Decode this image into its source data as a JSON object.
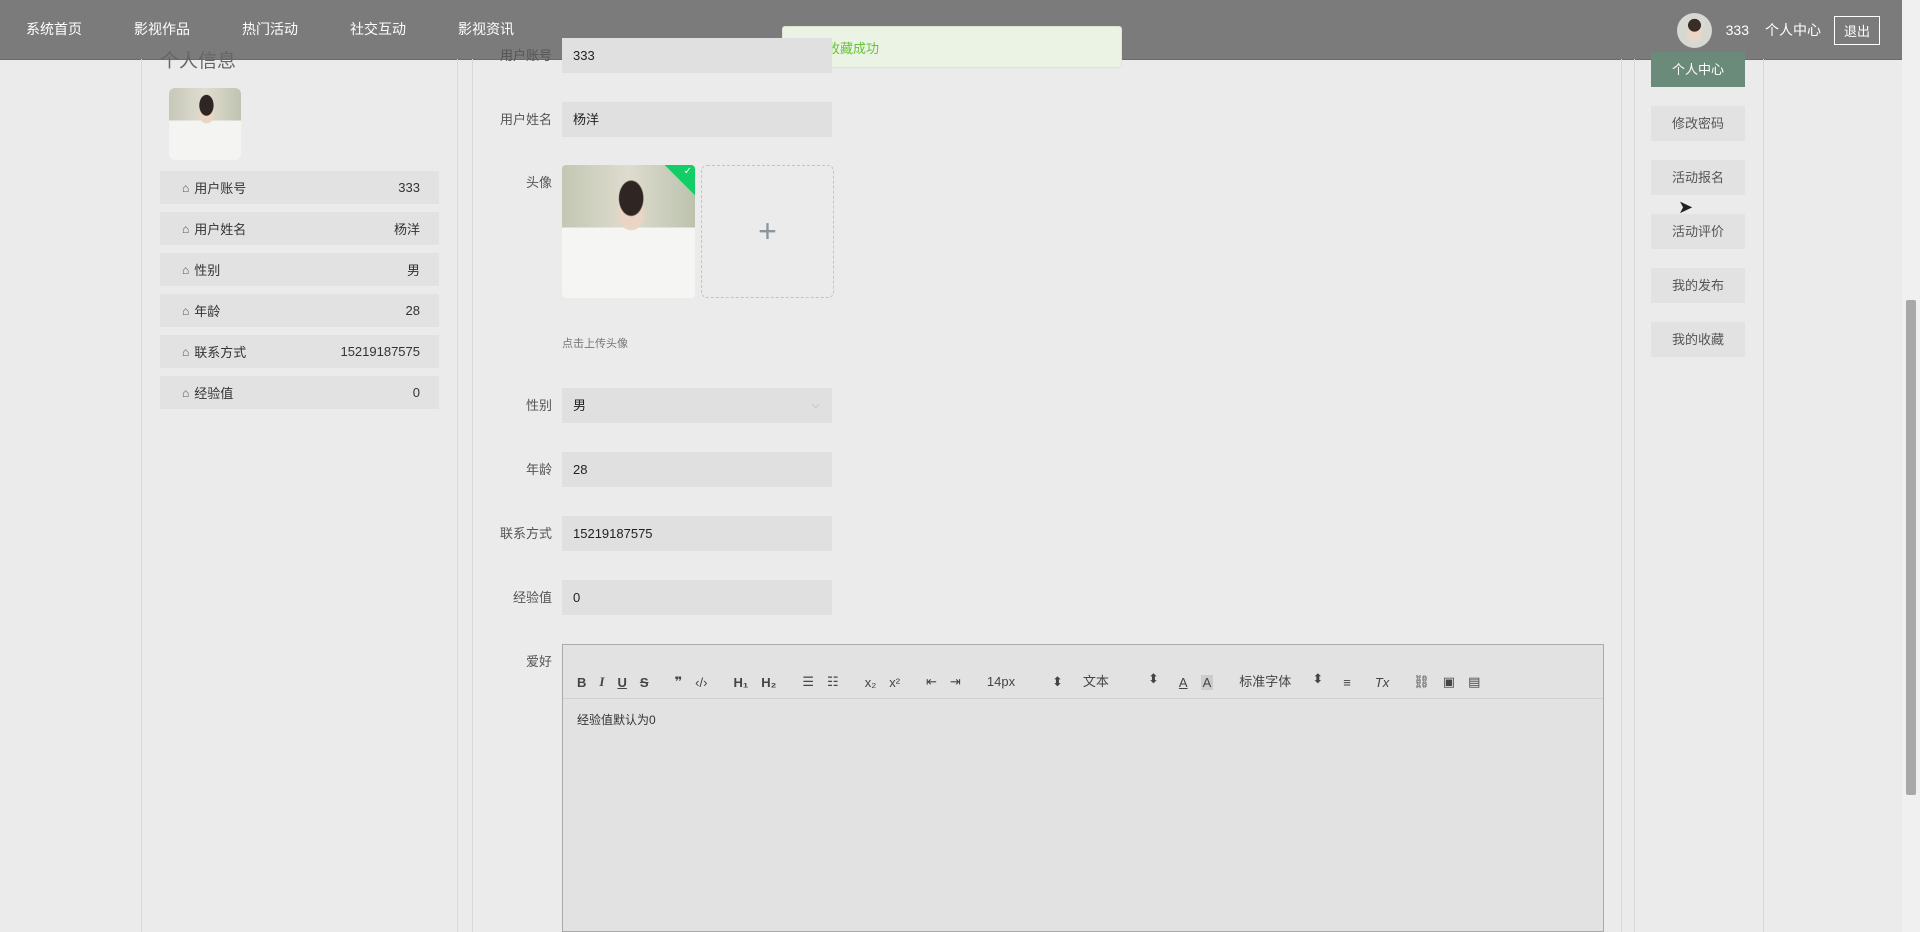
{
  "nav": {
    "items": [
      "系统首页",
      "影视作品",
      "热门活动",
      "社交互动",
      "影视资讯"
    ]
  },
  "topbar": {
    "username": "333",
    "personal_center": "个人中心",
    "logout": "退出"
  },
  "toast": {
    "message": "收藏成功",
    "icon": "success-check-icon"
  },
  "profile": {
    "title": "个人信息",
    "rows": [
      {
        "label": "用户账号",
        "value": "333"
      },
      {
        "label": "用户姓名",
        "value": "杨洋"
      },
      {
        "label": "性别",
        "value": "男"
      },
      {
        "label": "年龄",
        "value": "28"
      },
      {
        "label": "联系方式",
        "value": "15219187575"
      },
      {
        "label": "经验值",
        "value": "0"
      }
    ]
  },
  "form": {
    "account_label": "用户账号",
    "account_value": "333",
    "name_label": "用户姓名",
    "name_value": "杨洋",
    "avatar_label": "头像",
    "upload_tip": "点击上传头像",
    "upload_plus": "+",
    "gender_label": "性别",
    "gender_value": "男",
    "age_label": "年龄",
    "age_value": "28",
    "phone_label": "联系方式",
    "phone_value": "15219187575",
    "exp_label": "经验值",
    "exp_value": "0",
    "hobby_label": "爱好"
  },
  "editor": {
    "font_size": "14px",
    "text_type": "文本",
    "font_family": "标准字体",
    "content": "经验值默认为0"
  },
  "side_menu": [
    "个人中心",
    "修改密码",
    "活动报名",
    "活动评价",
    "我的发布",
    "我的收藏"
  ],
  "colors": {
    "topbar": "#7b7b7b",
    "active_menu": "#6b8b7a",
    "success": "#67c23a"
  }
}
